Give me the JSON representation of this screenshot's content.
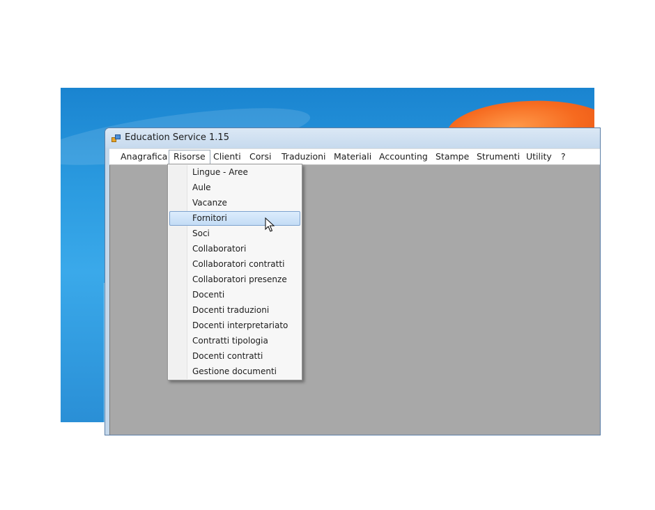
{
  "window": {
    "title": "Education Service 1.15"
  },
  "menubar": {
    "items": [
      {
        "label": "Anagrafica"
      },
      {
        "label": "Risorse"
      },
      {
        "label": "Clienti"
      },
      {
        "label": "Corsi"
      },
      {
        "label": "Traduzioni"
      },
      {
        "label": "Materiali"
      },
      {
        "label": "Accounting"
      },
      {
        "label": "Stampe"
      },
      {
        "label": "Strumenti"
      },
      {
        "label": "Utility"
      },
      {
        "label": "?"
      }
    ],
    "open_item": "Risorse"
  },
  "dropdown": {
    "items": [
      {
        "label": "Lingue - Aree"
      },
      {
        "label": "Aule"
      },
      {
        "label": "Vacanze"
      },
      {
        "label": "Fornitori"
      },
      {
        "label": "Soci"
      },
      {
        "label": "Collaboratori"
      },
      {
        "label": "Collaboratori contratti"
      },
      {
        "label": "Collaboratori presenze"
      },
      {
        "label": "Docenti"
      },
      {
        "label": "Docenti traduzioni"
      },
      {
        "label": "Docenti interpretariato"
      },
      {
        "label": "Contratti tipologia"
      },
      {
        "label": "Docenti contratti"
      },
      {
        "label": "Gestione documenti"
      }
    ],
    "highlighted": "Fornitori"
  },
  "icons": {
    "app": "app-icon",
    "cursor": "mouse-pointer-icon"
  },
  "colors": {
    "highlight": "#c3dcf5",
    "client_area": "#a8a8a8",
    "desktop": "#2b9be0"
  }
}
